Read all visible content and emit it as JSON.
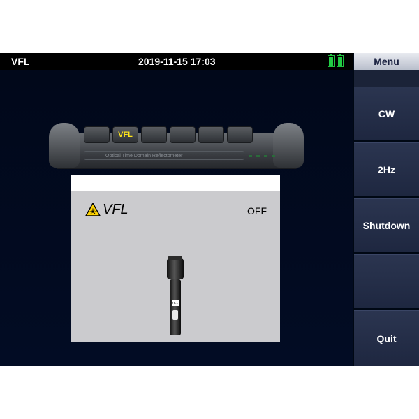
{
  "header": {
    "mode_title": "VFL",
    "datetime": "2019-11-15 17:03",
    "battery_icons": [
      "battery-full-icon",
      "battery-full-icon"
    ],
    "battery_color": "#22cc44"
  },
  "device": {
    "active_key_label": "VFL",
    "model_label": "Optical Time Domain Reflectometer"
  },
  "vfl_panel": {
    "title": "VFL",
    "state": "OFF",
    "switch_label": "OFF",
    "warning_icon": "laser-warning-icon",
    "warning_color": "#ffd400"
  },
  "menu": {
    "title": "Menu",
    "buttons": [
      {
        "label": "CW"
      },
      {
        "label": "2Hz"
      },
      {
        "label": "Shutdown"
      },
      {
        "label": ""
      },
      {
        "label": "Quit"
      }
    ]
  }
}
